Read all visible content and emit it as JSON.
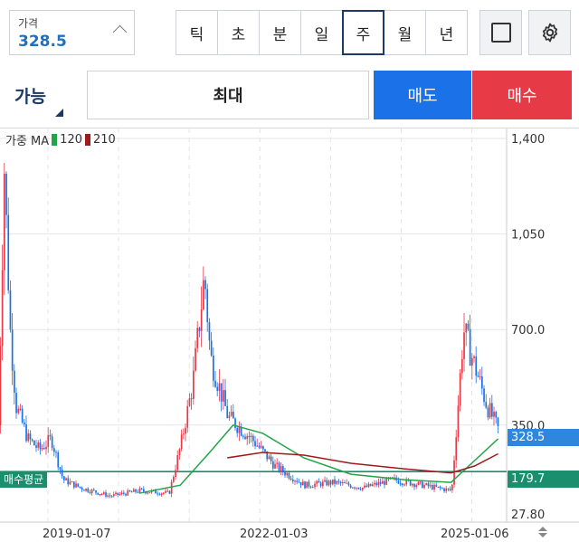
{
  "price_input": {
    "label": "가격",
    "value": "328.5"
  },
  "timeframes": [
    {
      "label": "틱",
      "active": false
    },
    {
      "label": "초",
      "active": false
    },
    {
      "label": "분",
      "active": false
    },
    {
      "label": "일",
      "active": false
    },
    {
      "label": "주",
      "active": true
    },
    {
      "label": "월",
      "active": false
    },
    {
      "label": "년",
      "active": false
    }
  ],
  "order": {
    "available_label": "가능",
    "quantity_label": "최대",
    "sell_label": "매도",
    "buy_label": "매수"
  },
  "colors": {
    "sell": "#1b72e8",
    "buy": "#e63a46",
    "up_candle": "#e63a46",
    "down_candle": "#1b72e8",
    "ma120": "#22a447",
    "ma210": "#9e1b1b",
    "avg_line": "#1a8f6d",
    "current_tag": "#2e86de"
  },
  "chart_data": {
    "type": "candlestick",
    "legend": {
      "label": "가중 MA",
      "ma_fast": "120",
      "ma_slow": "210"
    },
    "y_ticks": [
      "1,400",
      "1,050",
      "700.0",
      "350.0"
    ],
    "y_min_label": "27.80",
    "x_ticks": [
      "2019-01-07",
      "2022-01-03",
      "2025-01-06"
    ],
    "current_price": "328.5",
    "avg_buy_price": "179.7",
    "avg_buy_label": "매수평균",
    "ylim": [
      27.8,
      1400
    ],
    "series_close": [
      {
        "x": "2018-06",
        "close": 350
      },
      {
        "x": "2018-07",
        "close": 1300
      },
      {
        "x": "2018-08",
        "close": 700
      },
      {
        "x": "2018-09",
        "close": 420
      },
      {
        "x": "2018-11",
        "close": 300
      },
      {
        "x": "2019-01",
        "close": 260
      },
      {
        "x": "2019-03",
        "close": 300
      },
      {
        "x": "2019-05",
        "close": 150
      },
      {
        "x": "2019-08",
        "close": 120
      },
      {
        "x": "2020-01",
        "close": 90
      },
      {
        "x": "2020-06",
        "close": 110
      },
      {
        "x": "2020-11",
        "close": 100
      },
      {
        "x": "2021-01",
        "close": 280
      },
      {
        "x": "2021-03",
        "close": 500
      },
      {
        "x": "2021-05",
        "close": 900
      },
      {
        "x": "2021-06",
        "close": 600
      },
      {
        "x": "2021-09",
        "close": 380
      },
      {
        "x": "2022-01",
        "close": 300
      },
      {
        "x": "2022-05",
        "close": 200
      },
      {
        "x": "2022-10",
        "close": 130
      },
      {
        "x": "2023-03",
        "close": 140
      },
      {
        "x": "2023-08",
        "close": 120
      },
      {
        "x": "2024-01",
        "close": 150
      },
      {
        "x": "2024-06",
        "close": 130
      },
      {
        "x": "2024-11",
        "close": 110
      },
      {
        "x": "2025-01",
        "close": 700
      },
      {
        "x": "2025-03",
        "close": 560
      },
      {
        "x": "2025-05",
        "close": 420
      },
      {
        "x": "2025-07",
        "close": 328.5
      }
    ],
    "ma120": [
      {
        "x": "2020-06",
        "v": 100
      },
      {
        "x": "2021-01",
        "v": 130
      },
      {
        "x": "2021-06",
        "v": 250
      },
      {
        "x": "2021-10",
        "v": 350
      },
      {
        "x": "2022-03",
        "v": 320
      },
      {
        "x": "2022-10",
        "v": 230
      },
      {
        "x": "2023-06",
        "v": 170
      },
      {
        "x": "2024-03",
        "v": 150
      },
      {
        "x": "2024-11",
        "v": 140
      },
      {
        "x": "2025-03",
        "v": 220
      },
      {
        "x": "2025-07",
        "v": 300
      }
    ],
    "ma210": [
      {
        "x": "2021-09",
        "v": 230
      },
      {
        "x": "2022-03",
        "v": 250
      },
      {
        "x": "2022-10",
        "v": 240
      },
      {
        "x": "2023-06",
        "v": 210
      },
      {
        "x": "2024-03",
        "v": 190
      },
      {
        "x": "2024-11",
        "v": 175
      },
      {
        "x": "2025-03",
        "v": 200
      },
      {
        "x": "2025-07",
        "v": 245
      }
    ]
  }
}
